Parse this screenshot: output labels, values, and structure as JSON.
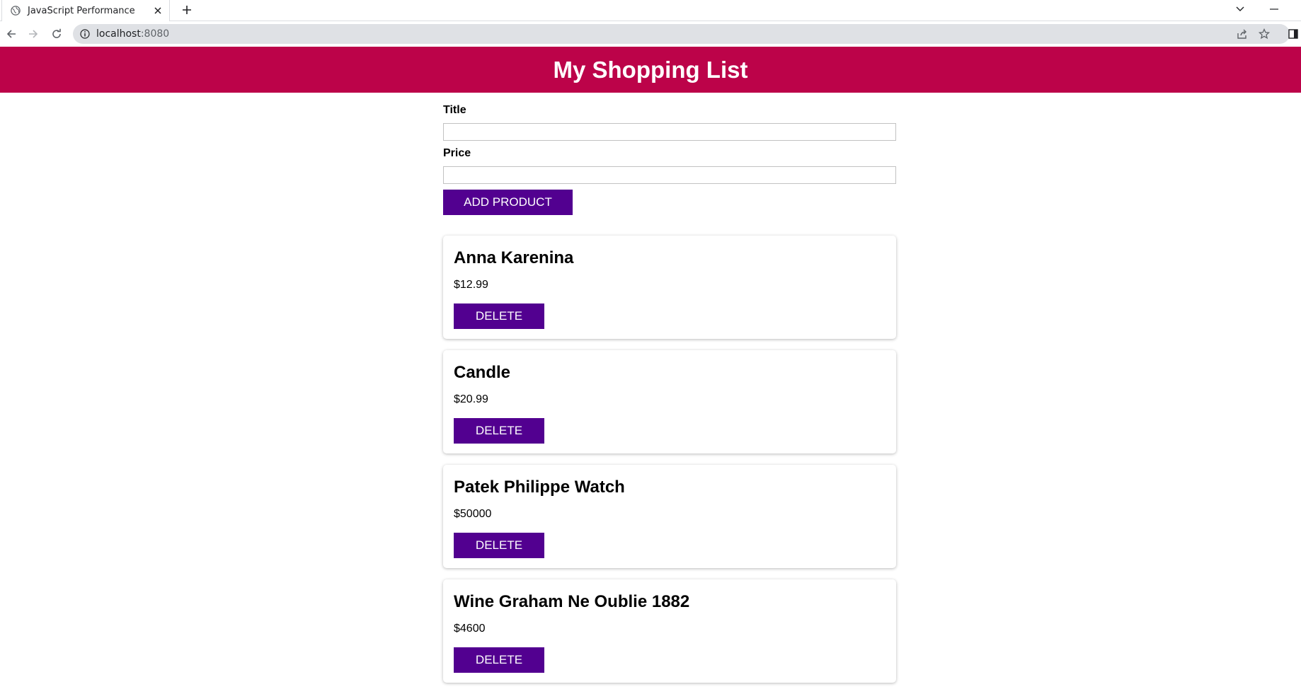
{
  "browser": {
    "tab_title": "JavaScript Performance",
    "url_host": "localhost",
    "url_port": ":8080"
  },
  "header": {
    "title": "My Shopping List"
  },
  "form": {
    "title_label": "Title",
    "title_value": "",
    "price_label": "Price",
    "price_value": "",
    "submit_label": "ADD PRODUCT"
  },
  "products": [
    {
      "title": "Anna Karenina",
      "price": "$12.99",
      "delete_label": "DELETE"
    },
    {
      "title": "Candle",
      "price": "$20.99",
      "delete_label": "DELETE"
    },
    {
      "title": "Patek Philippe Watch",
      "price": "$50000",
      "delete_label": "DELETE"
    },
    {
      "title": "Wine Graham Ne Oublie 1882",
      "price": "$4600",
      "delete_label": "DELETE"
    }
  ],
  "colors": {
    "header_bg": "#bc0349",
    "button_bg": "#520090"
  },
  "icons": [
    "globe-icon",
    "close-icon",
    "plus-icon",
    "chevron-down-icon",
    "minimize-icon",
    "back-icon",
    "forward-icon",
    "reload-icon",
    "info-icon",
    "share-icon",
    "star-icon",
    "side-panel-icon"
  ]
}
